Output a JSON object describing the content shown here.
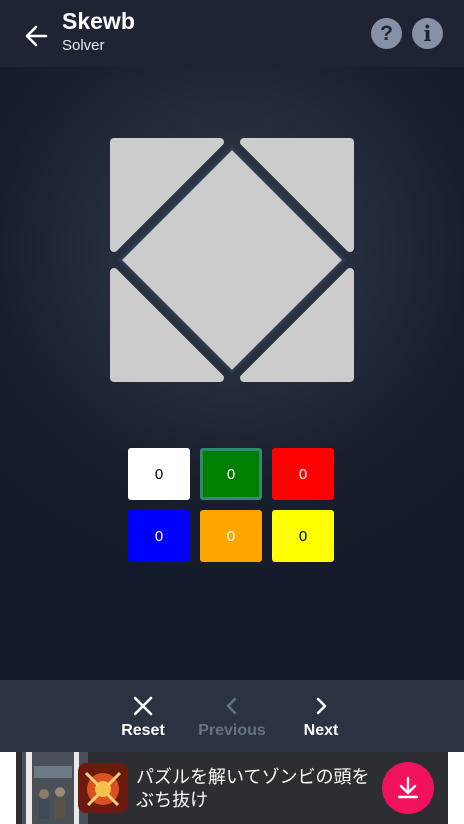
{
  "appbar": {
    "title": "Skewb",
    "subtitle": "Solver",
    "help_icon_glyph": "?",
    "info_icon_glyph": "i"
  },
  "face": {
    "sticker_color": "#cccccc",
    "outline_color": "#2f3a4e"
  },
  "palette": [
    {
      "color_name": "white",
      "hex": "#ffffff",
      "count": "0",
      "text_color": "#000000",
      "selected": false
    },
    {
      "color_name": "green",
      "hex": "#008000",
      "count": "0",
      "text_color": "#ffffff",
      "selected": true
    },
    {
      "color_name": "red",
      "hex": "#ff0000",
      "count": "0",
      "text_color": "#ffffff",
      "selected": false
    },
    {
      "color_name": "blue",
      "hex": "#0000ff",
      "count": "0",
      "text_color": "#ffffff",
      "selected": false
    },
    {
      "color_name": "orange",
      "hex": "#ffa500",
      "count": "0",
      "text_color": "#ffffff",
      "selected": false
    },
    {
      "color_name": "yellow",
      "hex": "#ffff00",
      "count": "0",
      "text_color": "#000000",
      "selected": false
    }
  ],
  "bottom_nav": {
    "reset_label": "Reset",
    "previous_label": "Previous",
    "next_label": "Next"
  },
  "ad": {
    "text": "パズルを解いてゾンビの頭をぶち抜け",
    "accent": "#f0125d"
  }
}
